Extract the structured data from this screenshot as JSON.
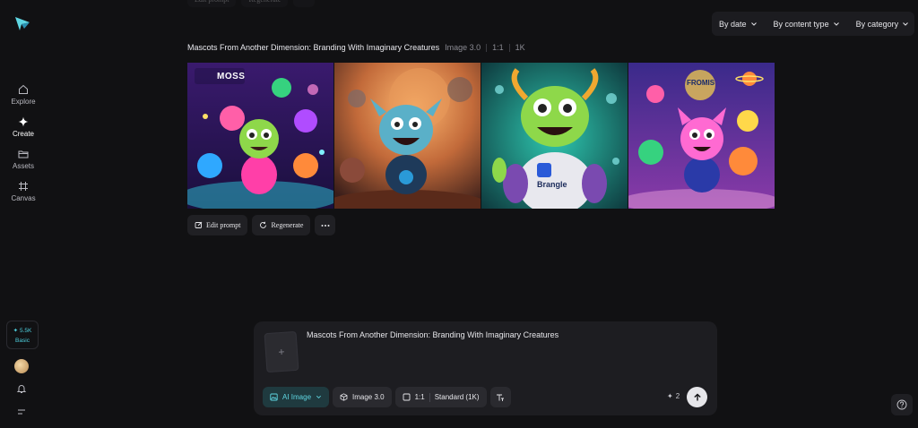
{
  "sidebar": {
    "items": [
      {
        "label": "Explore",
        "icon": "home-icon"
      },
      {
        "label": "Create",
        "icon": "sparkle-icon",
        "active": true
      },
      {
        "label": "Assets",
        "icon": "folder-icon"
      },
      {
        "label": "Canvas",
        "icon": "grid-icon"
      }
    ],
    "credits": {
      "amount": "5.5K",
      "plan": "Basic"
    }
  },
  "ghost_toolbar": {
    "edit": "Edit prompt",
    "regen": "Regenerate"
  },
  "filters": [
    "By date",
    "By content type",
    "By category"
  ],
  "generation": {
    "prompt": "Mascots From Another Dimension: Branding With Imaginary Creatures",
    "model": "Image 3.0",
    "ratio": "1:1",
    "resolution": "1K",
    "images": [
      {
        "caption": "MOSS"
      },
      {
        "caption": ""
      },
      {
        "caption": "Brangle"
      },
      {
        "caption": "FROMIS"
      }
    ]
  },
  "actions": {
    "edit_prompt": "Edit prompt",
    "regenerate": "Regenerate"
  },
  "composer": {
    "prompt_text": "Mascots From Another Dimension: Branding With Imaginary Creatures",
    "mode": "AI Image",
    "model": "Image 3.0",
    "ratio": "1:1",
    "quality": "Standard (1K)",
    "count": "2"
  },
  "colors": {
    "accent": "#5fd6e2",
    "background": "#111113",
    "panel": "#1d1d21"
  }
}
